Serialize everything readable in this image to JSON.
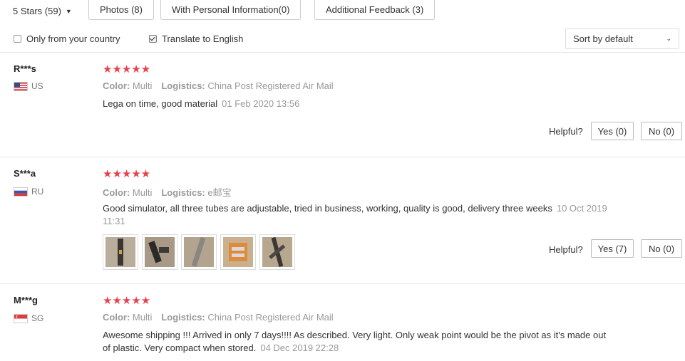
{
  "filters": {
    "stars_label": "5 Stars (59)",
    "photos_label": "Photos (8)",
    "personal_label": "With Personal Information(0)",
    "additional_label": "Additional Feedback (3)",
    "only_country_label": "Only from your country",
    "only_country_checked": false,
    "translate_label": "Translate to English",
    "translate_checked": true,
    "sort_label": "Sort by default"
  },
  "labels": {
    "color": "Color:",
    "logistics": "Logistics:",
    "helpful": "Helpful?"
  },
  "colors": {
    "star": "#e8414b",
    "muted": "#999999"
  },
  "reviews": [
    {
      "name": "R***s",
      "country": "US",
      "stars": "★★★★★",
      "color": "Multi",
      "logistics": "China Post Registered Air Mail",
      "text": "Lega on time, good material",
      "date": "01 Feb 2020 13:56",
      "yes": "Yes (0)",
      "no": "No (0)"
    },
    {
      "name": "S***a",
      "country": "RU",
      "stars": "★★★★★",
      "color": "Multi",
      "logistics": "e邮宝",
      "text": "Good simulator, all three tubes are adjustable, tried in business, working, quality is good, delivery three weeks",
      "date": "10 Oct 2019 11:31",
      "photo_count": 5,
      "yes": "Yes (7)",
      "no": "No (0)"
    },
    {
      "name": "M***g",
      "country": "SG",
      "stars": "★★★★★",
      "color": "Multi",
      "logistics": "China Post Registered Air Mail",
      "text": "Awesome shipping !!! Arrived in only 7 days!!!! As described. Very light. Only weak point would be the pivot as it's made out of plastic. Very compact when stored.",
      "date": "04 Dec 2019 22:28"
    }
  ]
}
